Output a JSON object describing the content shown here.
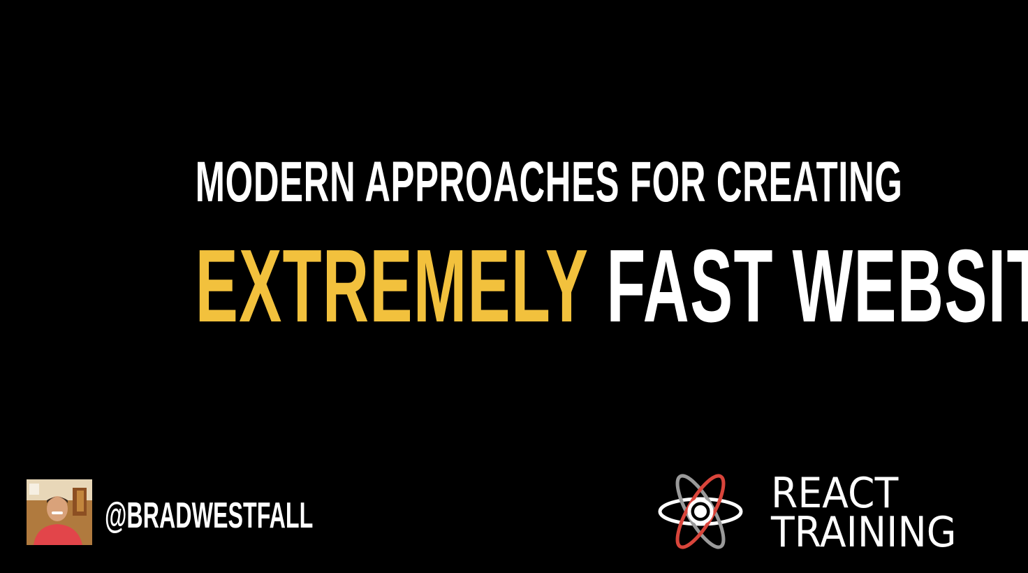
{
  "slide": {
    "title_line1": "MODERN APPROACHES FOR CREATING",
    "title_highlight": "EXTREMELY",
    "title_rest": "FAST WEBSITES",
    "twitter_handle": "@BRADWESTFALL",
    "brand_line1": "REACT",
    "brand_line2": "TRAINING"
  },
  "colors": {
    "background": "#000000",
    "text": "#ffffff",
    "highlight": "#f2c13d",
    "logo_orbit_red": "#d9453b",
    "logo_orbit_gray": "#9a9a9a"
  },
  "icons": {
    "avatar": "presenter-photo",
    "logo": "react-atom-logo"
  }
}
